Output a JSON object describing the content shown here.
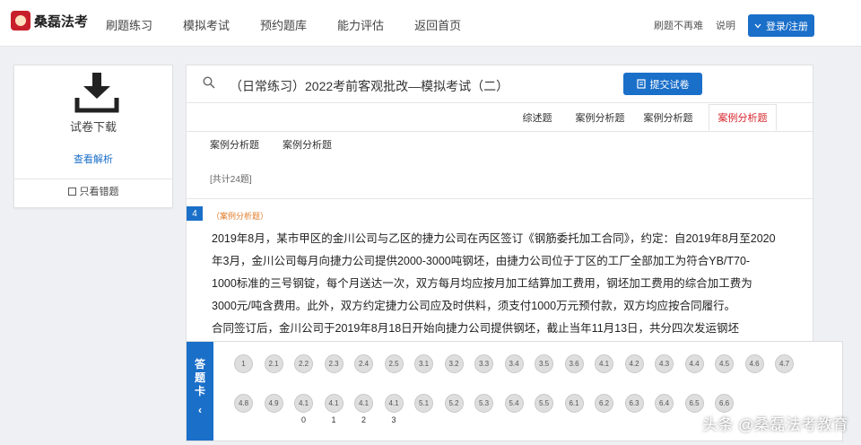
{
  "header": {
    "logo_text": "桑磊法考",
    "nav": [
      "刷题练习",
      "模拟考试",
      "预约题库",
      "能力评估",
      "返回首页"
    ],
    "user_links": [
      "刷题不再难",
      "说明"
    ],
    "login_label": "登录/注册"
  },
  "left_panel": {
    "download_label": "试卷下载",
    "view_label": "查看解析",
    "only_wrong_label": "只看错题"
  },
  "main": {
    "exam_title": "（日常练习）2022考前客观批改—模拟考试（二）",
    "submit_label": "提交试卷",
    "tabs": [
      "综述题",
      "案例分析题",
      "案例分析题",
      "案例分析题"
    ],
    "active_tab_index": 3,
    "subtabs": [
      "案例分析题",
      "案例分析题"
    ],
    "total_text": "[共计24题]",
    "question": {
      "number": "4",
      "type_label": "（案例分析题）",
      "lines": [
        "2019年8月，某市甲区的金川公司与乙区的捷力公司在丙区签订《钢筋委托加工合同》，约定：自2019年8月至2020",
        "年3月，金川公司每月向捷力公司提供2000-3000吨钢坯，由捷力公司位于丁区的工厂全部加工为符合YB/T70-",
        "1000标准的三号钢锭，每个月送达一次，双方每月均应按月加工结算加工费用，钢坯加工费用的综合加工费为",
        "3000元/吨含费用。此外，双方约定捷力公司应及时供料，须支付1000万元预付款，双方均应按合同履行。",
        "合同签订后，金川公司于2019年8月18日开始向捷力公司提供钢坯，截止当年11月13日，共分四次发运钢坯"
      ]
    }
  },
  "answer_card": {
    "side_label": [
      "答",
      "题",
      "卡",
      "‹"
    ],
    "bubbles": [
      {
        "label": "1",
        "sub": ""
      },
      {
        "label": "2.1",
        "sub": ""
      },
      {
        "label": "2.2",
        "sub": ""
      },
      {
        "label": "2.3",
        "sub": ""
      },
      {
        "label": "2.4",
        "sub": ""
      },
      {
        "label": "2.5",
        "sub": ""
      },
      {
        "label": "3.1",
        "sub": ""
      },
      {
        "label": "3.2",
        "sub": ""
      },
      {
        "label": "3.3",
        "sub": ""
      },
      {
        "label": "3.4",
        "sub": ""
      },
      {
        "label": "3.5",
        "sub": ""
      },
      {
        "label": "3.6",
        "sub": ""
      },
      {
        "label": "4.1",
        "sub": ""
      },
      {
        "label": "4.2",
        "sub": ""
      },
      {
        "label": "4.3",
        "sub": ""
      },
      {
        "label": "4.4",
        "sub": ""
      },
      {
        "label": "4.5",
        "sub": ""
      },
      {
        "label": "4.6",
        "sub": ""
      },
      {
        "label": "4.7",
        "sub": ""
      },
      {
        "label": "4.8",
        "sub": ""
      },
      {
        "label": "4.9",
        "sub": ""
      },
      {
        "label": "4.1",
        "sub": "0"
      },
      {
        "label": "4.1",
        "sub": "1"
      },
      {
        "label": "4.1",
        "sub": "2"
      },
      {
        "label": "4.1",
        "sub": "3"
      },
      {
        "label": "5.1",
        "sub": ""
      },
      {
        "label": "5.2",
        "sub": ""
      },
      {
        "label": "5.3",
        "sub": ""
      },
      {
        "label": "5.4",
        "sub": ""
      },
      {
        "label": "5.5",
        "sub": ""
      },
      {
        "label": "6.1",
        "sub": ""
      },
      {
        "label": "6.2",
        "sub": ""
      },
      {
        "label": "6.3",
        "sub": ""
      },
      {
        "label": "6.4",
        "sub": ""
      },
      {
        "label": "6.5",
        "sub": ""
      },
      {
        "label": "6.6",
        "sub": ""
      }
    ]
  },
  "watermark": "头条 @桑磊法考教育",
  "colors": {
    "accent": "#1a6fc9",
    "active_tab": "#d6262d",
    "question_type": "#e07b2a"
  },
  "icons": {
    "logo": "avatar-logo-icon",
    "download": "download-icon",
    "search": "search-icon",
    "submit": "document-icon",
    "login": "chevron-down-icon"
  }
}
